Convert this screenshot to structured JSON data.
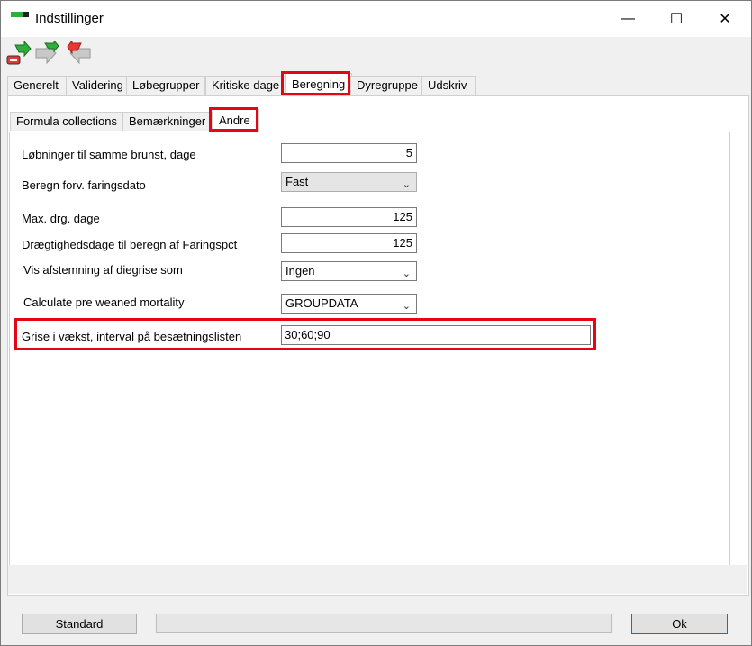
{
  "window": {
    "title": "Indstillinger",
    "minimize_glyph": "—",
    "maximize_glyph": "☐",
    "close_glyph": "✕"
  },
  "toolbar": {
    "icons": [
      "save-green-arrow-icon",
      "forward-arrow-icon",
      "back-red-arrow-icon"
    ]
  },
  "main_tabs": [
    {
      "label": "Generelt"
    },
    {
      "label": "Validering"
    },
    {
      "label": "Løbegrupper"
    },
    {
      "label": "Kritiske dage"
    },
    {
      "label": "Beregning",
      "active": true
    },
    {
      "label": "Dyregruppe"
    },
    {
      "label": "Udskriv"
    }
  ],
  "sub_tabs": [
    {
      "label": "Formula collections"
    },
    {
      "label": "Bemærkninger"
    },
    {
      "label": "Andre",
      "active": true
    }
  ],
  "fields": {
    "lobninger": {
      "label": "Løbninger til samme brunst, dage",
      "value": "5"
    },
    "beregn_forv": {
      "label": "Beregn forv. faringsdato",
      "value": "Fast"
    },
    "max_drg": {
      "label": "Max. drg. dage",
      "value": "125"
    },
    "draegtighed": {
      "label": "Drægtighedsdage til beregn af Faringspct",
      "value": "125"
    },
    "vis_afstemning": {
      "label": "Vis afstemning af diegrise som",
      "value": "Ingen"
    },
    "calc_mortality": {
      "label": "Calculate pre weaned mortality",
      "value": "GROUPDATA"
    },
    "grise_interval": {
      "label": "Grise i vækst, interval på besætningslisten",
      "value": "30;60;90"
    }
  },
  "footer": {
    "standard_label": "Standard",
    "ok_label": "Ok"
  },
  "colors": {
    "highlight": "#e30613",
    "accent_green": "#2fae3a"
  }
}
